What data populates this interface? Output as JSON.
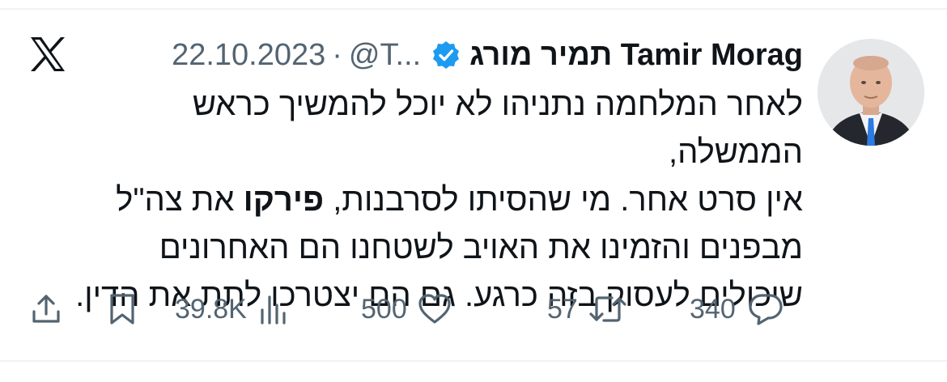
{
  "author": {
    "display_name": "Tamir Morag תמיר מורג",
    "handle": "@T...",
    "separator": "·",
    "date": "22.10.2023",
    "verified": true,
    "avatar": "profile-photo"
  },
  "brand": {
    "logo": "x-logo",
    "text_color": "#0f1419",
    "muted_color": "#536471",
    "verified_color": "#1d9bf0"
  },
  "tweet": {
    "line1": "לאחר המלחמה נתניהו לא יוכל להמשיך כראש הממשלה,",
    "line2_part1": "אין סרט אחר. מי שהסיתו לסרבנות, ",
    "line2_bold": "פירקו",
    "line2_part2": " את צה\"ל",
    "line3": "מבפנים והזמינו את האויב לשטחנו הם האחרונים",
    "line4": "שיכולים לעסוק בזה כרגע. גם הם יצטרכו לתת את הדין."
  },
  "actions": {
    "share": {
      "icon": "share-icon"
    },
    "bookmark": {
      "icon": "bookmark-icon"
    },
    "views": {
      "icon": "views-icon",
      "count": "39.8K"
    },
    "likes": {
      "icon": "heart-icon",
      "count": "500"
    },
    "reposts": {
      "icon": "repost-icon",
      "count": "57"
    },
    "replies": {
      "icon": "reply-icon",
      "count": "340"
    }
  }
}
